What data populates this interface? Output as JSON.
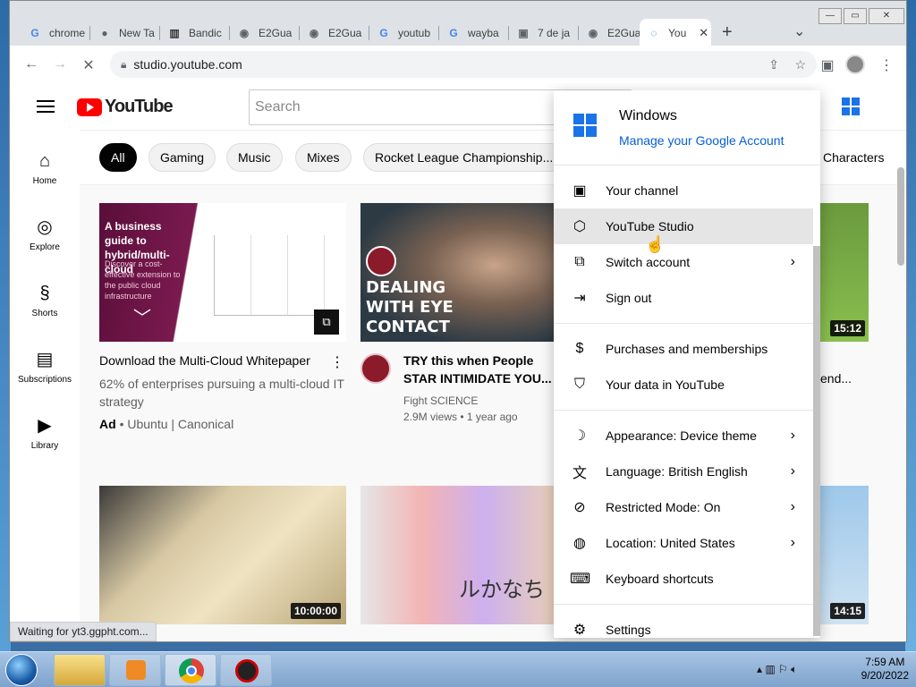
{
  "browser": {
    "tabs": [
      {
        "label": "chrome",
        "fav": "G",
        "fav_color": "#4285f4"
      },
      {
        "label": "New Ta",
        "fav": "●",
        "fav_color": "#5f6368"
      },
      {
        "label": "Bandic",
        "fav": "▥",
        "fav_color": "#333333"
      },
      {
        "label": "E2Gua",
        "fav": "◉",
        "fav_color": "#5f6368"
      },
      {
        "label": "E2Gua",
        "fav": "◉",
        "fav_color": "#5f6368"
      },
      {
        "label": "youtub",
        "fav": "G",
        "fav_color": "#4285f4"
      },
      {
        "label": "wayba",
        "fav": "G",
        "fav_color": "#4285f4"
      },
      {
        "label": "7 de ja",
        "fav": "▣",
        "fav_color": "#5f6368"
      },
      {
        "label": "E2Gua",
        "fav": "◉",
        "fav_color": "#5f6368"
      },
      {
        "label": "You",
        "fav": "◌",
        "fav_color": "#1a73e8"
      }
    ],
    "new_tab": "+",
    "tab_menu": "⌄",
    "window_controls": [
      "—",
      "▭",
      "✕"
    ],
    "url": "studio.youtube.com",
    "status": "Waiting for yt3.ggpht.com..."
  },
  "youtube": {
    "logo_text": "YouTube",
    "search_placeholder": "Search",
    "sidebar": [
      {
        "label": "Home",
        "icon": "⌂"
      },
      {
        "label": "Explore",
        "icon": "◎"
      },
      {
        "label": "Shorts",
        "icon": "§"
      },
      {
        "label": "Subscriptions",
        "icon": "▤"
      },
      {
        "label": "Library",
        "icon": "▶"
      }
    ],
    "chips": [
      "All",
      "Gaming",
      "Music",
      "Mixes",
      "Rocket League Championship...",
      "Characters"
    ],
    "videos": [
      {
        "thumb_title": "A business guide to hybrid/multi-cloud",
        "thumb_sub": "Discover a cost-effective extension to the public cloud infrastructure",
        "title": "Download the Multi-Cloud Whitepaper",
        "desc": "62% of enterprises pursuing a multi-cloud IT strategy",
        "ad": "Ad",
        "advertiser": "• Ubuntu | Canonical"
      },
      {
        "thumb_text": "DEALING WITH EYE CONTACT",
        "title": "TRY this when People STAR INTIMIDATE YOU... SIMPLE",
        "channel": "Fight SCIENCE",
        "meta": "2.9M views • 1 year ago"
      },
      {
        "duration": "15:12",
        "title": "end..."
      },
      {
        "duration": "10:00:00"
      },
      {
        "thumb_text": "ルかなち"
      },
      {
        "duration": "14:15"
      }
    ]
  },
  "account_menu": {
    "name": "Windows",
    "manage": "Manage your Google Account",
    "items": [
      {
        "label": "Your channel",
        "icon": "person-box",
        "chev": false
      },
      {
        "label": "YouTube Studio",
        "icon": "studio",
        "chev": false
      },
      {
        "label": "Switch account",
        "icon": "switch",
        "chev": true
      },
      {
        "label": "Sign out",
        "icon": "signout",
        "chev": false
      },
      {
        "label": "Purchases and memberships",
        "icon": "dollar",
        "chev": false
      },
      {
        "label": "Your data in YouTube",
        "icon": "shield",
        "chev": false
      },
      {
        "label": "Appearance: Device theme",
        "icon": "moon",
        "chev": true
      },
      {
        "label": "Language: British English",
        "icon": "translate",
        "chev": true
      },
      {
        "label": "Restricted Mode: On",
        "icon": "restricted",
        "chev": true
      },
      {
        "label": "Location: United States",
        "icon": "globe",
        "chev": true
      },
      {
        "label": "Keyboard shortcuts",
        "icon": "keyboard",
        "chev": false
      },
      {
        "label": "Settings",
        "icon": "gear",
        "chev": false
      }
    ],
    "chevron": "›"
  },
  "taskbar": {
    "time": "7:59 AM",
    "date": "9/20/2022"
  }
}
